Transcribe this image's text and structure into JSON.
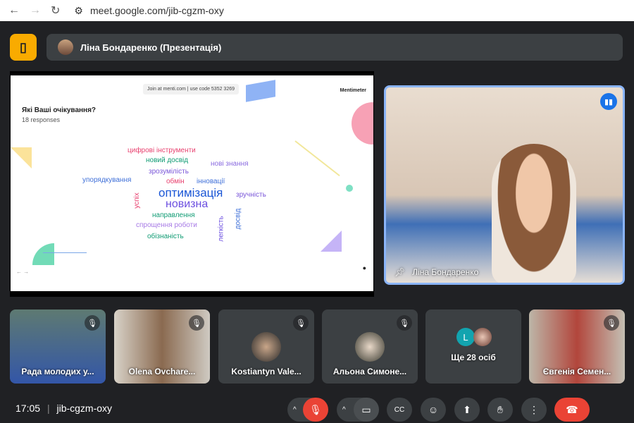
{
  "browser": {
    "url": "meet.google.com/jib-cgzm-oxy"
  },
  "header": {
    "presenter": "Ліна Бондаренко (Презентація)"
  },
  "slide": {
    "join": "Join at menti.com | use code  5352 3269",
    "brand": "Mentimeter",
    "question": "Які Ваші очікування?",
    "responses": "18 responses",
    "words": [
      "цифрові інструменти",
      "новий досвід",
      "нові знання",
      "зрозумілість",
      "упорядкування",
      "обмін",
      "інновації",
      "оптимізація",
      "зручність",
      "успіх",
      "новизна",
      "направлення",
      "спрощення роботи",
      "легкість",
      "досвід",
      "обізнаність"
    ]
  },
  "speaker": {
    "name": "Ліна Бондаренко"
  },
  "tiles": [
    {
      "name": "Рада молодих у..."
    },
    {
      "name": "Olena Ovchare..."
    },
    {
      "name": "Kostiantyn Vale..."
    },
    {
      "name": "Альона Симоне..."
    },
    {
      "name": "Ще 28 осіб",
      "avatar_letter": "L"
    },
    {
      "name": "Євгенія Семен..."
    }
  ],
  "footer": {
    "time": "17:05",
    "separator": "|",
    "code": "jib-cgzm-oxy"
  },
  "colors": {
    "accent": "#8ab4f8",
    "end_call": "#ea4335",
    "bg": "#202124"
  }
}
